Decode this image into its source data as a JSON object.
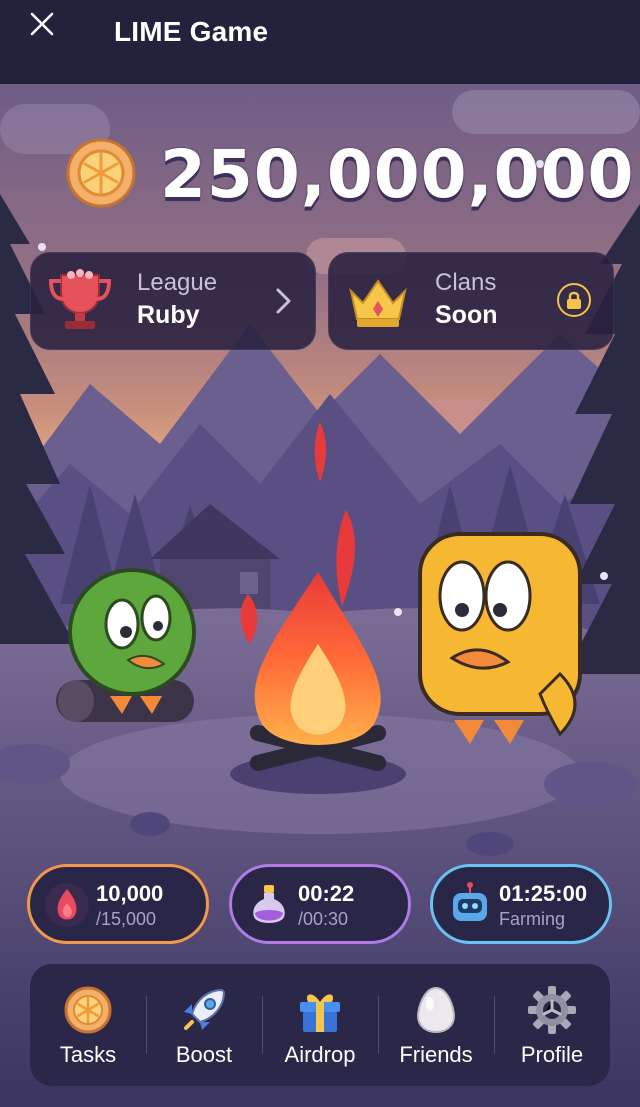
{
  "app": {
    "title": "LIME Game"
  },
  "balance": {
    "value": "250,000,000"
  },
  "cards": {
    "league": {
      "label": "League",
      "value": "Ruby"
    },
    "clans": {
      "label": "Clans",
      "value": "Soon"
    }
  },
  "stats": {
    "energy": {
      "current": "10,000",
      "max": "/15,000"
    },
    "potion": {
      "time": "00:22",
      "total": "/00:30"
    },
    "farming": {
      "time": "01:25:00",
      "label": "Farming"
    }
  },
  "nav": [
    {
      "label": "Tasks",
      "icon": "orange-coin-icon"
    },
    {
      "label": "Boost",
      "icon": "rocket-icon"
    },
    {
      "label": "Airdrop",
      "icon": "gift-icon"
    },
    {
      "label": "Friends",
      "icon": "egg-icon"
    },
    {
      "label": "Profile",
      "icon": "gear-icon"
    }
  ],
  "colors": {
    "topbar": "#23223d",
    "energy_border": "#f29a4a",
    "potion_border": "#b07ae8",
    "farming_border": "#69c2f2",
    "lock_ring": "#f2c24b"
  }
}
